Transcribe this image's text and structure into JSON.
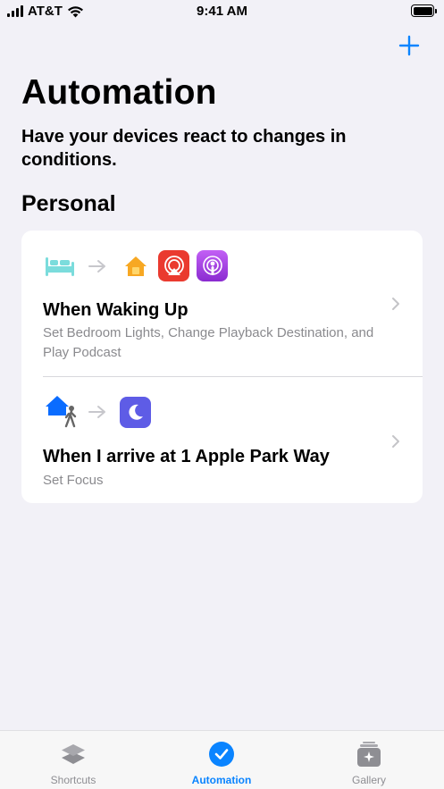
{
  "status_bar": {
    "carrier": "AT&T",
    "time": "9:41 AM"
  },
  "header": {
    "title": "Automation",
    "subtitle": "Have your devices react to changes in conditions."
  },
  "section": {
    "title": "Personal"
  },
  "automations": [
    {
      "title": "When Waking Up",
      "description": "Set Bedroom Lights, Change Playback Destination, and Play Podcast",
      "trigger_icon": "bed-icon",
      "action_icons": [
        "home-app-icon",
        "airplay-app-icon",
        "podcasts-app-icon"
      ]
    },
    {
      "title": "When I arrive at 1 Apple Park Way",
      "description": "Set Focus",
      "trigger_icon": "arrive-home-icon",
      "action_icons": [
        "focus-moon-icon"
      ]
    }
  ],
  "tab_bar": {
    "tabs": [
      {
        "label": "Shortcuts",
        "icon": "shortcuts-icon"
      },
      {
        "label": "Automation",
        "icon": "automation-clock-icon"
      },
      {
        "label": "Gallery",
        "icon": "gallery-icon"
      }
    ],
    "active": "Automation"
  },
  "colors": {
    "accent": "#0A84FF",
    "background": "#F2F1F7",
    "card": "#FFFFFF",
    "secondary_text": "#8A8A8E",
    "bed": "#7BDCDC",
    "home_app": "#F7A823",
    "airplay_app": "#EA3A2F",
    "podcasts_app": "#A44AE0",
    "focus_app": "#5E5CE6"
  }
}
